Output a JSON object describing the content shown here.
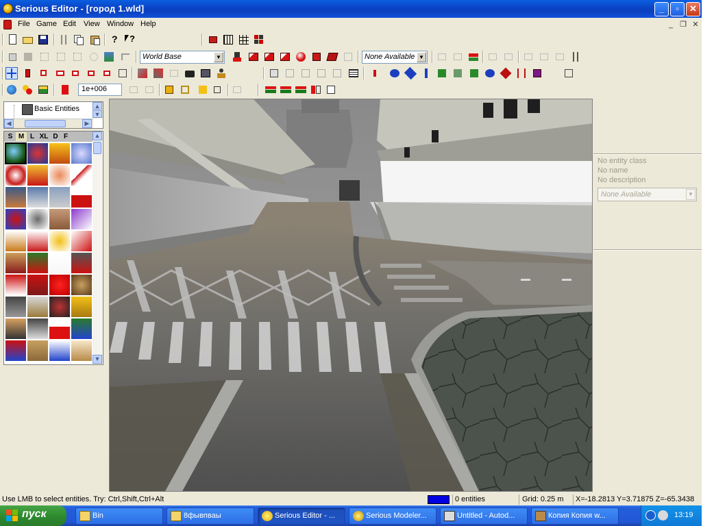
{
  "window": {
    "title": "Serious Editor - [город 1.wld]",
    "buttons": {
      "minimize": "_",
      "maximize": "▫",
      "close": "✕"
    }
  },
  "menu": [
    "File",
    "Game",
    "Edit",
    "View",
    "Window",
    "Help"
  ],
  "mdi_controls": {
    "minimize": "_",
    "restore": "❐",
    "close": "✕"
  },
  "toolbar": {
    "base_combo": "World Base",
    "target_combo": "None Available",
    "value_input": "1e+006"
  },
  "browser": {
    "tree_label": "Basic Entities",
    "size_tabs": [
      "S",
      "M",
      "L",
      "XL",
      "D",
      "F"
    ],
    "active_tab": "M"
  },
  "properties": {
    "entity_class": "No entity class",
    "name": "No name",
    "description": "No description",
    "combo": "None Available"
  },
  "status": {
    "hint": "Use LMB to select entities. Try: Ctrl,Shift,Ctrl+Alt",
    "entities": "0 entities",
    "grid": "Grid: 0.25 m",
    "coords": "X=-18.2813 Y=3.71875 Z=-65.3438",
    "swatch_color": "#0000e0"
  },
  "taskbar": {
    "start": "пуск",
    "tasks": [
      "Bin",
      "8фывпваы",
      "Serious Editor - ...",
      "Serious Modeler...",
      "Untitled - Autod...",
      "Копия Копия w..."
    ],
    "active_index": 2,
    "clock": "13:19"
  }
}
